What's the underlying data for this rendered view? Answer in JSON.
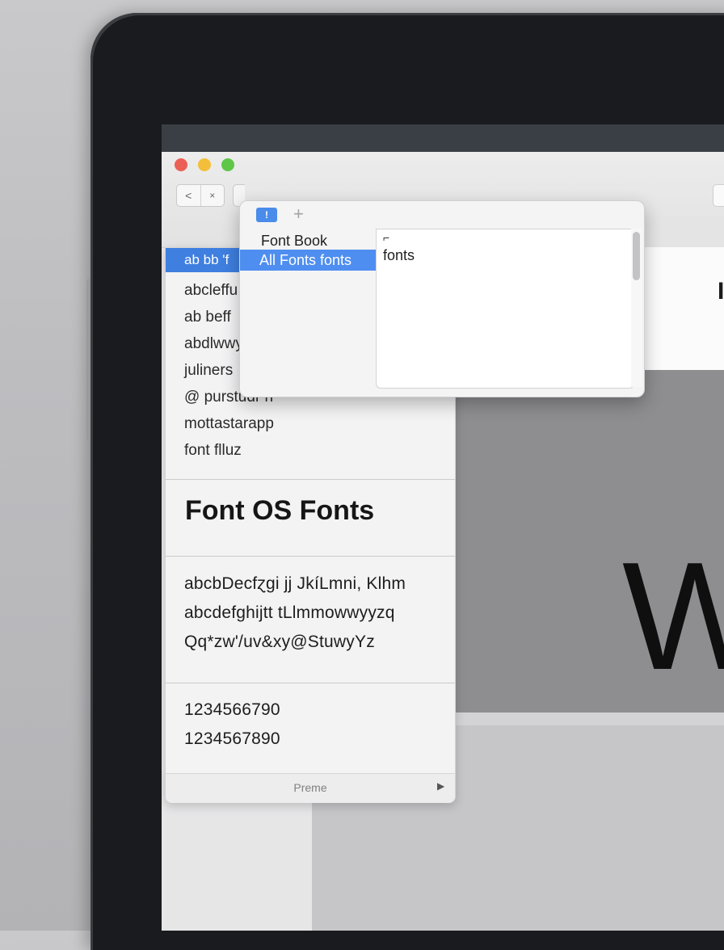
{
  "window": {
    "nav_back": "<",
    "nav_close": "×"
  },
  "popover": {
    "toolbar_button": "!",
    "add_button": "+",
    "menu": [
      "Font Book",
      "All Fonts fonts"
    ],
    "list_marker": "⌐",
    "list_items": [
      "fonts"
    ]
  },
  "font_list": {
    "selected": "ab bb 'f",
    "items": [
      "abcleffu",
      "ab beff",
      "abdlwwy",
      "juliners",
      "@ purstudr n",
      "mottastarapp",
      "font flluz"
    ]
  },
  "sample": {
    "heading": "Font OS Fonts",
    "alphabet": [
      "abcbDecfɀgi jj JkíLmni, Klhm",
      "abcdefghijtt tLlmmowwyyzq",
      "Qq*zw'/uv&xy@StuwyYz"
    ],
    "numbers": [
      "1234566790",
      "1234567890"
    ],
    "footer": "Preme"
  },
  "preview": {
    "title_glyph": "I",
    "large_glyph": "W"
  }
}
